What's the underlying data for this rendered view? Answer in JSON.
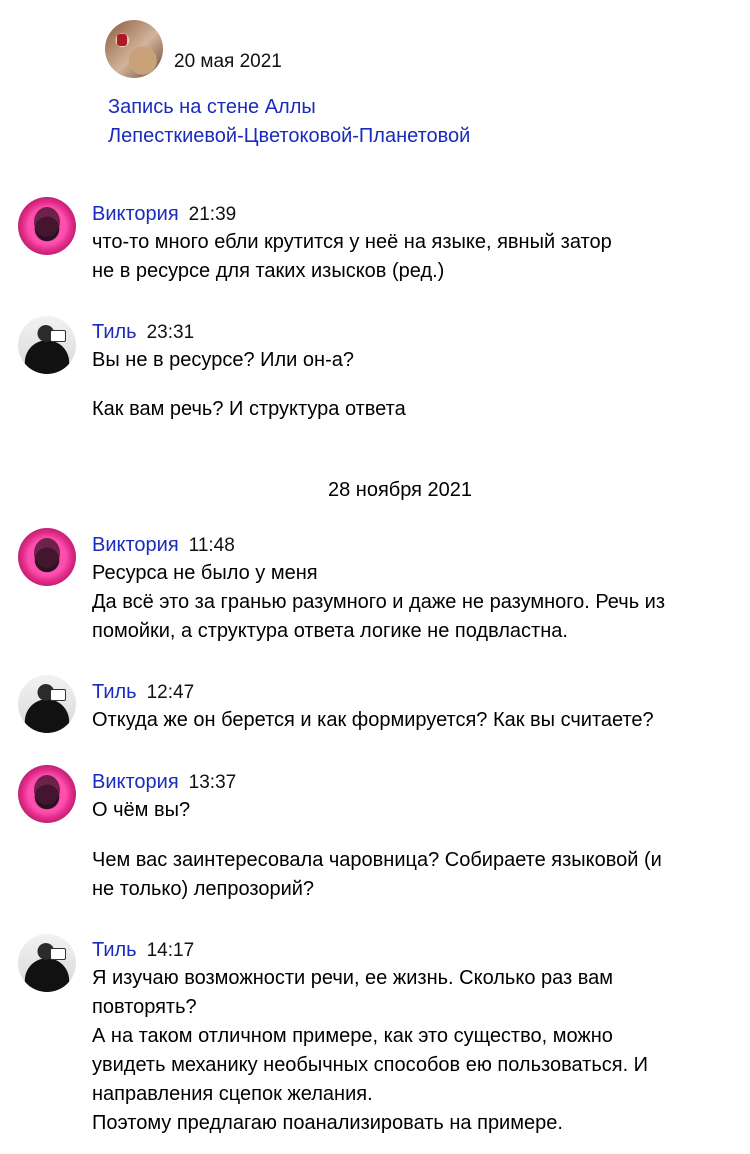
{
  "post": {
    "date": "20 мая 2021",
    "link_line1": "Запись на стене Аллы",
    "link_line2": "Лепесткиевой-Цветоковой-Планетовой"
  },
  "separator": {
    "date": "28 ноября 2021"
  },
  "messages": [
    {
      "author": "Виктория",
      "time": "21:39",
      "lines": [
        "что-то много ебли крутится у неё на языке, явный затор",
        "не в ресурсе для таких изысков (ред.)"
      ]
    },
    {
      "author": "Тиль",
      "time": "23:31",
      "lines": [
        "Вы не в ресурсе? Или он-а?",
        "Как вам речь? И структура ответа"
      ]
    },
    {
      "author": "Виктория",
      "time": "11:48",
      "lines": [
        "Ресурса не было у меня",
        "Да всё это за гранью разумного и даже не разумного. Речь из",
        "помойки, а структура ответа логике не подвластна."
      ]
    },
    {
      "author": "Тиль",
      "time": "12:47",
      "lines": [
        "Откуда же он берется и как формируется? Как вы считаете?"
      ]
    },
    {
      "author": "Виктория",
      "time": "13:37",
      "lines": [
        "О чём вы?",
        "Чем вас заинтересовала чаровница? Собираете языковой (и",
        "не только) лепрозорий?"
      ]
    },
    {
      "author": "Тиль",
      "time": "14:17",
      "lines": [
        "Я изучаю возможности речи, ее жизнь. Сколько раз вам",
        "повторять?",
        "А на таком отличном примере, как это существо, можно",
        "увидеть механику необычных способов ею пользоваться. И",
        "направления сцепок желания.",
        "Поэтому предлагаю поанализировать на примере."
      ]
    }
  ],
  "colors": {
    "link": "#1a2bbd",
    "text": "#000000"
  },
  "icons": {
    "post_avatar": "post-author-avatar",
    "viktoria_avatar": "viktoria-avatar",
    "til_avatar": "til-avatar"
  }
}
